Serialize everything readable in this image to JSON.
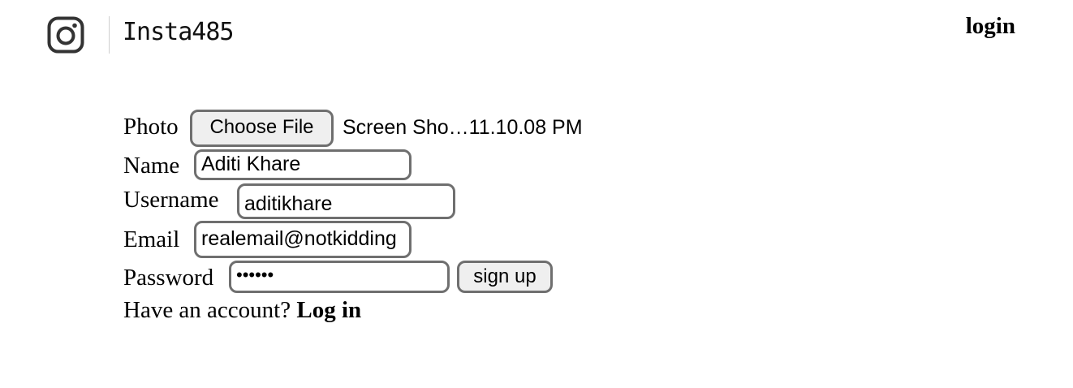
{
  "header": {
    "logo_icon": "instagram-icon",
    "brand": "Insta485",
    "nav_login": "login"
  },
  "form": {
    "photo": {
      "label": "Photo",
      "button_label": "Choose File",
      "file_name": "Screen Sho…11.10.08 PM"
    },
    "name": {
      "label": "Name",
      "value": "Aditi Khare"
    },
    "username": {
      "label": "Username",
      "value": "aditikhare"
    },
    "email": {
      "label": "Email",
      "value": "realemail@notkidding"
    },
    "password": {
      "label": "Password",
      "masked_value": "••••••"
    },
    "submit_label": "sign up"
  },
  "footer": {
    "prompt": "Have an account?",
    "login_link": "Log in"
  },
  "colors": {
    "input_border": "#6f6f6f",
    "button_bg": "#efefef"
  }
}
